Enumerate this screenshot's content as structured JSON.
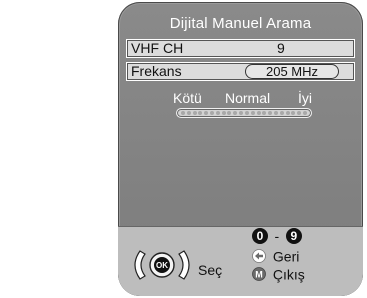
{
  "screen": {
    "title": "Dijital Manuel Arama",
    "channel": {
      "band": "VHF",
      "label": "CH",
      "value": "9"
    },
    "frequency": {
      "label": "Frekans",
      "value": "205 MHz"
    },
    "quality": {
      "labels": [
        "Kötü",
        "Normal",
        "İyi"
      ],
      "level": 0.0
    },
    "footer": {
      "select_label": "Seç",
      "number_keys": [
        "0",
        "9"
      ],
      "range_separator": "-",
      "back_label": "Geri",
      "exit_label": "Çıkış",
      "ok_icon_text": "OK",
      "menu_icon_text": "M"
    }
  },
  "colors": {
    "panel": "#8a8a8a",
    "row": "#dcdcdc",
    "footer": "#bdbdbd",
    "accent": "#ffffff"
  }
}
